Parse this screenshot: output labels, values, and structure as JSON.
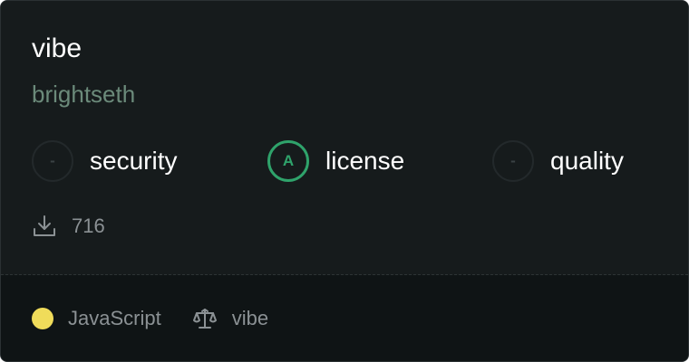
{
  "package": {
    "name": "vibe",
    "owner": "brightseth"
  },
  "scores": [
    {
      "label": "security",
      "grade": "-",
      "status": "none"
    },
    {
      "label": "license",
      "grade": "A",
      "status": "good"
    },
    {
      "label": "quality",
      "grade": "-",
      "status": "none"
    }
  ],
  "downloads": {
    "icon": "download-icon",
    "count": "716"
  },
  "footer": {
    "language": "JavaScript",
    "language_color": "#f0dc5a",
    "license_icon": "scale-icon",
    "license": "vibe"
  },
  "colors": {
    "grade_good": "#2fa36b",
    "owner_text": "#6b8a7a"
  }
}
